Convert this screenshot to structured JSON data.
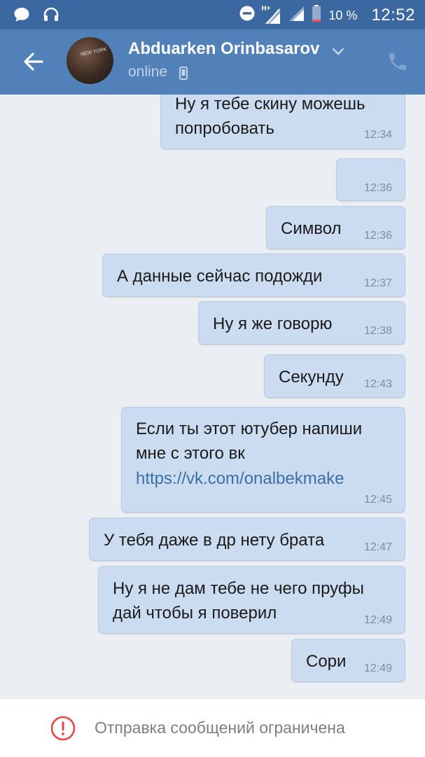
{
  "status_bar": {
    "network": "H+",
    "battery_percent": "10 %",
    "time": "12:52"
  },
  "header": {
    "contact_name": "Abduarken Orinbasarov",
    "contact_status": "online",
    "avatar_print": "NEW YORK"
  },
  "messages": [
    {
      "text": [
        "Ну я тебе скину можешь",
        "попробовать"
      ],
      "time": "12:34"
    },
    {
      "text": [],
      "time": "12:36"
    },
    {
      "text": [
        "Символ"
      ],
      "time": "12:36"
    },
    {
      "text": [
        "А данные сейчас подожди"
      ],
      "time": "12:37"
    },
    {
      "text": [
        "Ну я же говорю"
      ],
      "time": "12:38"
    },
    {
      "text": [
        "Секунду"
      ],
      "time": "12:43"
    },
    {
      "text": [
        "Если ты этот ютубер напиши",
        "мне с этого вк"
      ],
      "link": "https://vk.com/onalbekmake",
      "time": "12:45"
    },
    {
      "text": [
        "У тебя даже в др нету брата"
      ],
      "time": "12:47"
    },
    {
      "text": [
        "Ну я не дам тебе не чего пруфы",
        "дай чтобы я поверил"
      ],
      "time": "12:49"
    },
    {
      "text": [
        "Сори"
      ],
      "time": "12:49"
    }
  ],
  "footer": {
    "restriction_text": "Отправка сообщений ограничена"
  },
  "colors": {
    "status_bar": "#3b68a0",
    "app_bar": "#5181b8",
    "background": "#ebeff4",
    "bubble_out": "#cbdcf0",
    "link": "#3c6fa6",
    "warning": "#e64646"
  },
  "icons": [
    "message-icon",
    "headset-icon",
    "dnd-icon",
    "signal-icon",
    "battery-icon",
    "back-arrow-icon",
    "chevron-down-icon",
    "mobile-icon",
    "phone-icon",
    "warning-icon"
  ]
}
